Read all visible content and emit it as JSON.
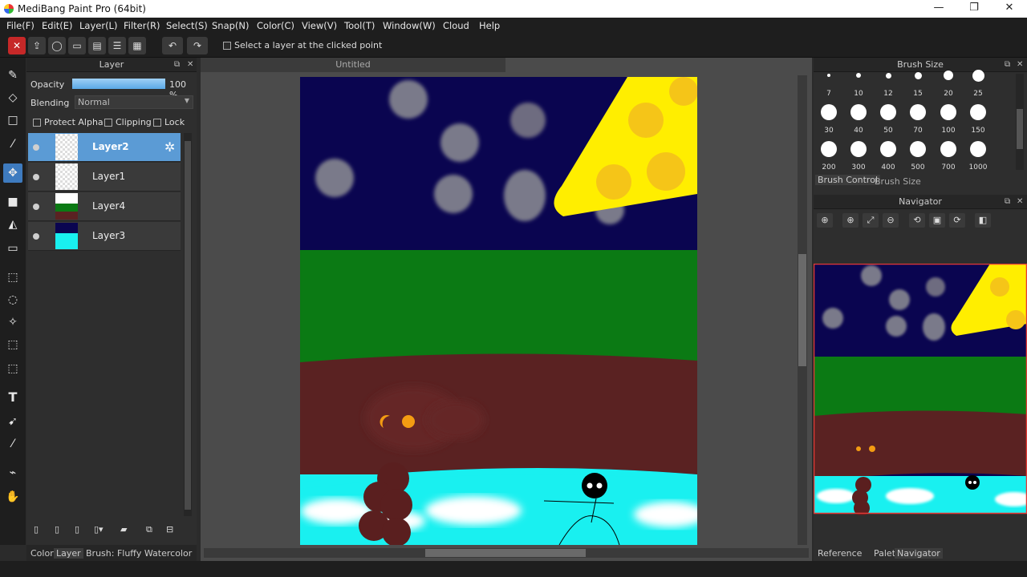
{
  "window": {
    "title": "MediBang Paint Pro (64bit)",
    "min": "—",
    "max": "❐",
    "close": "✕"
  },
  "menu": [
    "File(F)",
    "Edit(E)",
    "Layer(L)",
    "Filter(R)",
    "Select(S)",
    "Snap(N)",
    "Color(C)",
    "View(V)",
    "Tool(T)",
    "Window(W)",
    "Cloud",
    "Help"
  ],
  "toolbar": {
    "select_layer_label": "Select a layer at the clicked point"
  },
  "layer_panel": {
    "title": "Layer",
    "opacity_label": "Opacity",
    "opacity_value": "100 %",
    "opacity_fraction": 1.0,
    "blending_label": "Blending",
    "blending_value": "Normal",
    "protect_alpha": "Protect Alpha",
    "clipping": "Clipping",
    "lock": "Lock",
    "layers": [
      {
        "name": "Layer2",
        "selected": true
      },
      {
        "name": "Layer1",
        "selected": false
      },
      {
        "name": "Layer4",
        "selected": false
      },
      {
        "name": "Layer3",
        "selected": false
      }
    ]
  },
  "document": {
    "title": "Untitled"
  },
  "brush_size": {
    "title": "Brush Size",
    "sizes": [
      "7",
      "10",
      "12",
      "15",
      "20",
      "25",
      "30",
      "40",
      "50",
      "70",
      "100",
      "150",
      "200",
      "300",
      "400",
      "500",
      "700",
      "1000"
    ],
    "tab_control": "Brush Control",
    "tab_size": "Brush Size"
  },
  "navigator": {
    "title": "Navigator"
  },
  "bottom_tabs_left": {
    "color": "Color",
    "layer": "Layer",
    "brush": "Brush: Fluffy Watercolor"
  },
  "bottom_tabs_right": {
    "reference": "Reference",
    "palette": "Palette",
    "navigator": "Navigator"
  },
  "colors": {
    "accent": "#5b9bd5",
    "sky": "#0a0550",
    "grass": "#0b7a14",
    "dirt": "#5a2222",
    "water": "#19f0f0",
    "sun": "#ffee00"
  }
}
